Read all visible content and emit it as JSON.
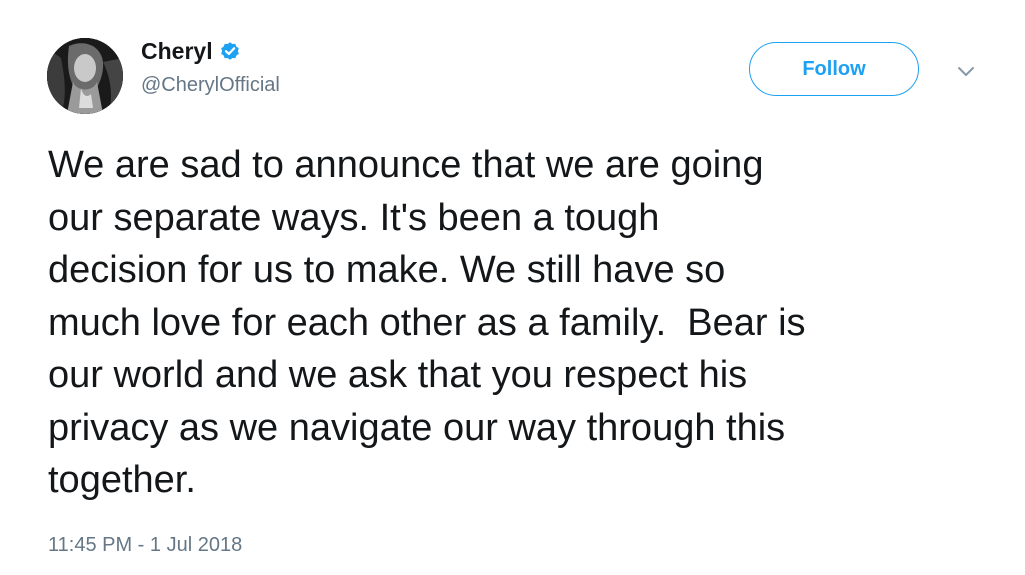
{
  "author": {
    "display_name": "Cheryl",
    "handle": "@CherylOfficial",
    "verified": true,
    "avatar_icon": "profile-photo"
  },
  "actions": {
    "follow_label": "Follow",
    "more_icon": "chevron-down-icon"
  },
  "tweet": {
    "text": "We are sad to announce that we are going\nour separate ways. It's been a tough\ndecision for us to make. We still have so\nmuch love for each other as a family.  Bear is\nour world and we ask that you respect his\nprivacy as we navigate our way through this\ntogether.",
    "timestamp": "11:45 PM - 1 Jul 2018"
  },
  "colors": {
    "accent": "#1da1f2",
    "text": "#14171a",
    "muted": "#657786"
  }
}
